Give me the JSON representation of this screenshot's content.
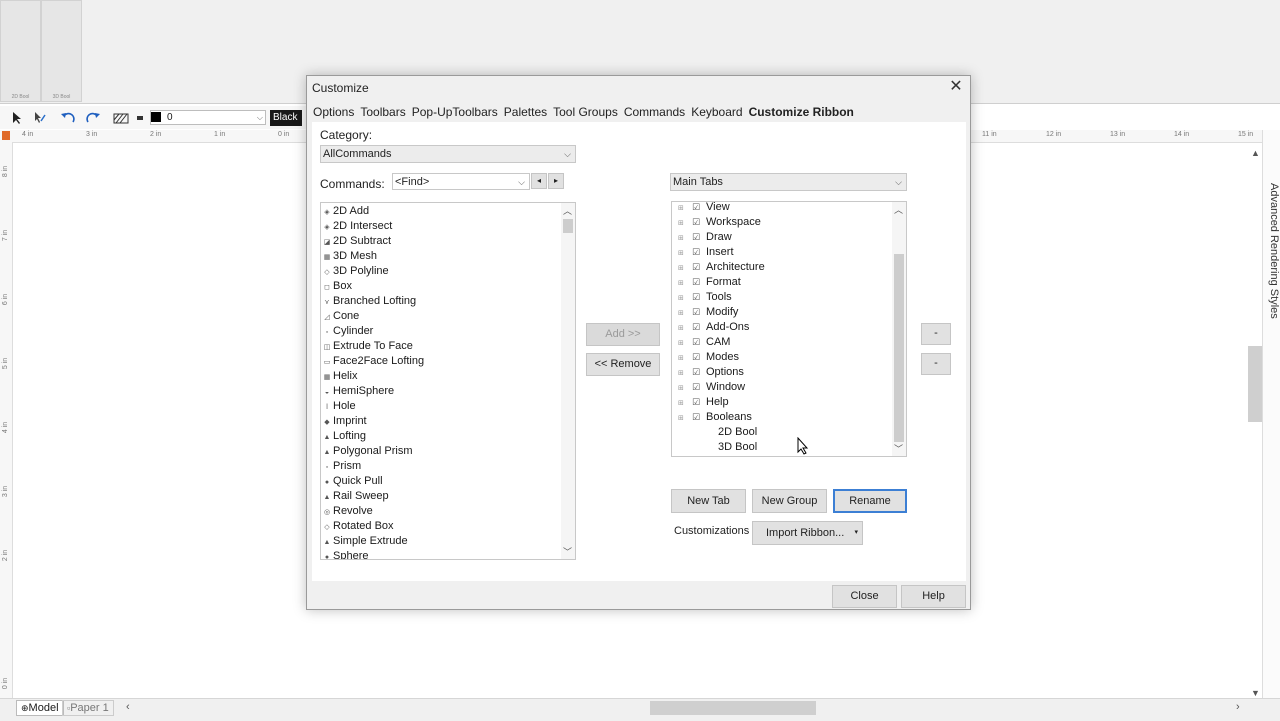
{
  "ribbon": {
    "buttons": [
      {
        "label": "2D Bool"
      },
      {
        "label": "3D Bool"
      }
    ]
  },
  "toolbar": {
    "line_value": "0",
    "color_label": "Black"
  },
  "ruler": {
    "h_ticks": [
      "4 in",
      "3 in",
      "2 in",
      "1 in",
      "0 in",
      "11 in",
      "12 in",
      "13 in",
      "14 in",
      "15 in"
    ],
    "v_ticks": [
      "8 in",
      "7 in",
      "6 in",
      "5 in",
      "4 in",
      "3 in",
      "2 in",
      "0 in"
    ]
  },
  "side_palette": {
    "label": "Advanced Rendering Styles"
  },
  "bottom_tabs": {
    "model": "Model",
    "paper": "Paper 1"
  },
  "dialog": {
    "title": "Customize",
    "close_glyph": "✕",
    "tabs": [
      "Options",
      "Toolbars",
      "Pop-UpToolbars",
      "Palettes",
      "Tool Groups",
      "Commands",
      "Keyboard",
      "Customize Ribbon"
    ],
    "category_label": "Category:",
    "category_value": "AllCommands",
    "commands_label": "Commands:",
    "find_value": "<Find>",
    "commands": [
      "2D Add",
      "2D Intersect",
      "2D Subtract",
      "3D Mesh",
      "3D Polyline",
      "Box",
      "Branched Lofting",
      "Cone",
      "Cylinder",
      "Extrude To Face",
      "Face2Face Lofting",
      "Helix",
      "HemiSphere",
      "Hole",
      "Imprint",
      "Lofting",
      "Polygonal Prism",
      "Prism",
      "Quick Pull",
      "Rail Sweep",
      "Revolve",
      "Rotated Box",
      "Simple Extrude",
      "Sphere"
    ],
    "add_label": "Add >>",
    "remove_label": "<< Remove",
    "tabs_combo_value": "Main Tabs",
    "ribbon_tree": [
      {
        "label": "View",
        "level": 0
      },
      {
        "label": "Workspace",
        "level": 0
      },
      {
        "label": "Draw",
        "level": 0
      },
      {
        "label": "Insert",
        "level": 0
      },
      {
        "label": "Architecture",
        "level": 0
      },
      {
        "label": "Format",
        "level": 0
      },
      {
        "label": "Tools",
        "level": 0
      },
      {
        "label": "Modify",
        "level": 0
      },
      {
        "label": "Add-Ons",
        "level": 0
      },
      {
        "label": "CAM",
        "level": 0
      },
      {
        "label": "Modes",
        "level": 0
      },
      {
        "label": "Options",
        "level": 0
      },
      {
        "label": "Window",
        "level": 0
      },
      {
        "label": "Help",
        "level": 0
      },
      {
        "label": "Booleans",
        "level": 0
      },
      {
        "label": "2D Bool",
        "level": 1
      },
      {
        "label": "3D Bool",
        "level": 1
      }
    ],
    "move_up_label": "-",
    "move_down_label": "-",
    "new_tab_label": "New Tab",
    "new_group_label": "New Group",
    "rename_label": "Rename",
    "customizations_label": "Customizations",
    "import_label": "Import Ribbon...",
    "close_label": "Close",
    "help_label": "Help"
  }
}
